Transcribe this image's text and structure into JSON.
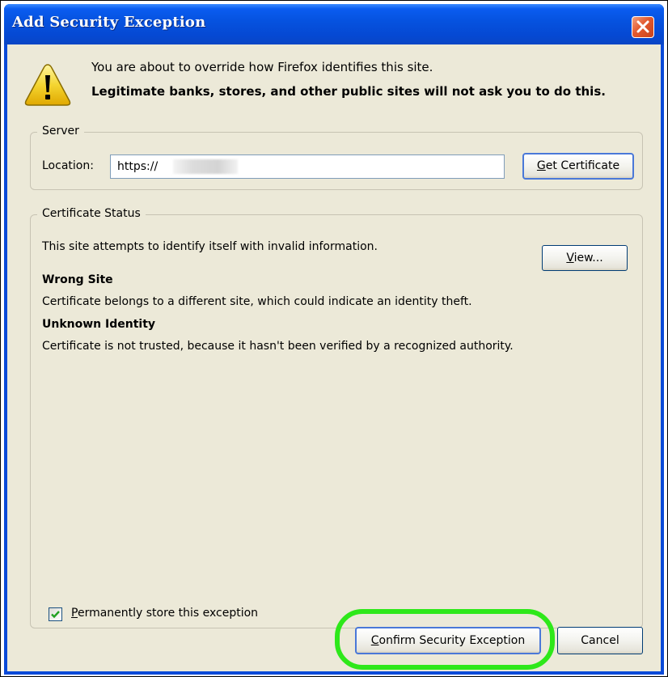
{
  "window": {
    "title": "Add Security Exception"
  },
  "message": {
    "line1": "You are about to override how Firefox identifies this site.",
    "line2": "Legitimate banks, stores, and other public sites will not ask you to do this."
  },
  "server": {
    "legend": "Server",
    "location_label": "Location:",
    "location_value": "https://            .52/",
    "get_certificate_label": "Get Certificate",
    "get_certificate_accesskey": "G"
  },
  "certificate_status": {
    "legend": "Certificate Status",
    "summary": "This site attempts to identify itself with invalid information.",
    "view_label": "View...",
    "view_accesskey": "V",
    "wrong_site_heading": "Wrong Site",
    "wrong_site_text": "Certificate belongs to a different site, which could indicate an identity theft.",
    "unknown_identity_heading": "Unknown Identity",
    "unknown_identity_text": "Certificate is not trusted, because it hasn't been verified by a recognized authority."
  },
  "permanent": {
    "label": "Permanently store this exception",
    "accesskey": "P",
    "checked": true
  },
  "buttons": {
    "confirm_label": "Confirm Security Exception",
    "confirm_accesskey": "C",
    "cancel_label": "Cancel"
  },
  "colors": {
    "titlebar_blue": "#0653e0",
    "dialog_face": "#ece9d8",
    "highlight_green": "#2ee81a",
    "close_red": "#e2582e",
    "warning_yellow": "#f4d531"
  },
  "icons": {
    "warning": "warning-icon",
    "close": "close-icon",
    "check": "checkmark-icon"
  }
}
